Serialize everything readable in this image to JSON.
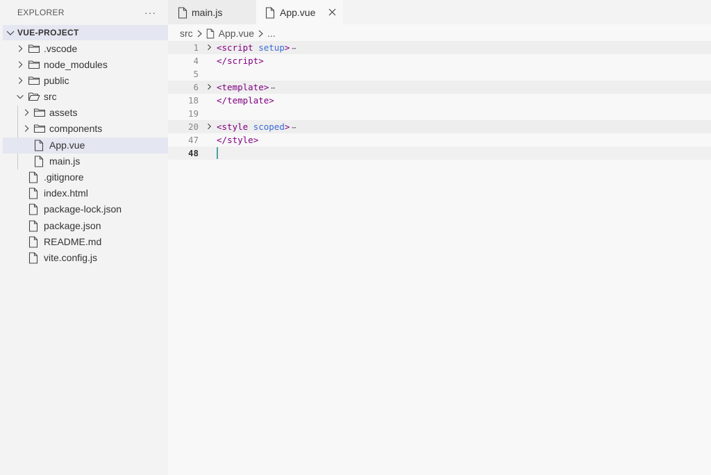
{
  "explorer": {
    "title": "EXPLORER",
    "more": "···",
    "project": "VUE-PROJECT",
    "items": [
      {
        "label": ".vscode",
        "type": "folder",
        "expanded": false
      },
      {
        "label": "node_modules",
        "type": "folder",
        "expanded": false
      },
      {
        "label": "public",
        "type": "folder",
        "expanded": false
      },
      {
        "label": "src",
        "type": "folder",
        "expanded": true
      },
      {
        "label": "assets",
        "type": "folder",
        "expanded": false
      },
      {
        "label": "components",
        "type": "folder",
        "expanded": false
      },
      {
        "label": "App.vue",
        "type": "file",
        "selected": true
      },
      {
        "label": "main.js",
        "type": "file"
      },
      {
        "label": ".gitignore",
        "type": "file"
      },
      {
        "label": "index.html",
        "type": "file"
      },
      {
        "label": "package-lock.json",
        "type": "file"
      },
      {
        "label": "package.json",
        "type": "file"
      },
      {
        "label": "README.md",
        "type": "file"
      },
      {
        "label": "vite.config.js",
        "type": "file"
      }
    ]
  },
  "tabs": [
    {
      "label": "main.js",
      "active": false
    },
    {
      "label": "App.vue",
      "active": true
    }
  ],
  "breadcrumb": {
    "folder": "src",
    "file": "App.vue",
    "more": "..."
  },
  "editor": {
    "lines": [
      {
        "num": "1",
        "open": "<",
        "name": "script",
        "attr": " setup",
        "close": ">",
        "folded": true
      },
      {
        "num": "4",
        "text_open": "</",
        "name": "script",
        "close": ">"
      },
      {
        "num": "5"
      },
      {
        "num": "6",
        "open": "<",
        "name": "template",
        "attr": "",
        "close": ">",
        "folded": true
      },
      {
        "num": "18",
        "text_open": "</",
        "name": "template",
        "close": ">"
      },
      {
        "num": "19"
      },
      {
        "num": "20",
        "open": "<",
        "name": "style",
        "attr": " scoped",
        "close": ">",
        "folded": true
      },
      {
        "num": "47",
        "text_open": "</",
        "name": "style",
        "close": ">"
      },
      {
        "num": "48",
        "current": true
      }
    ],
    "fold_ellipsis": "⋯"
  },
  "colors": {
    "tag": "#800080",
    "attr": "#3a6bd6",
    "selection": "#e4e6f1",
    "cursor": "#4aa0a0"
  }
}
